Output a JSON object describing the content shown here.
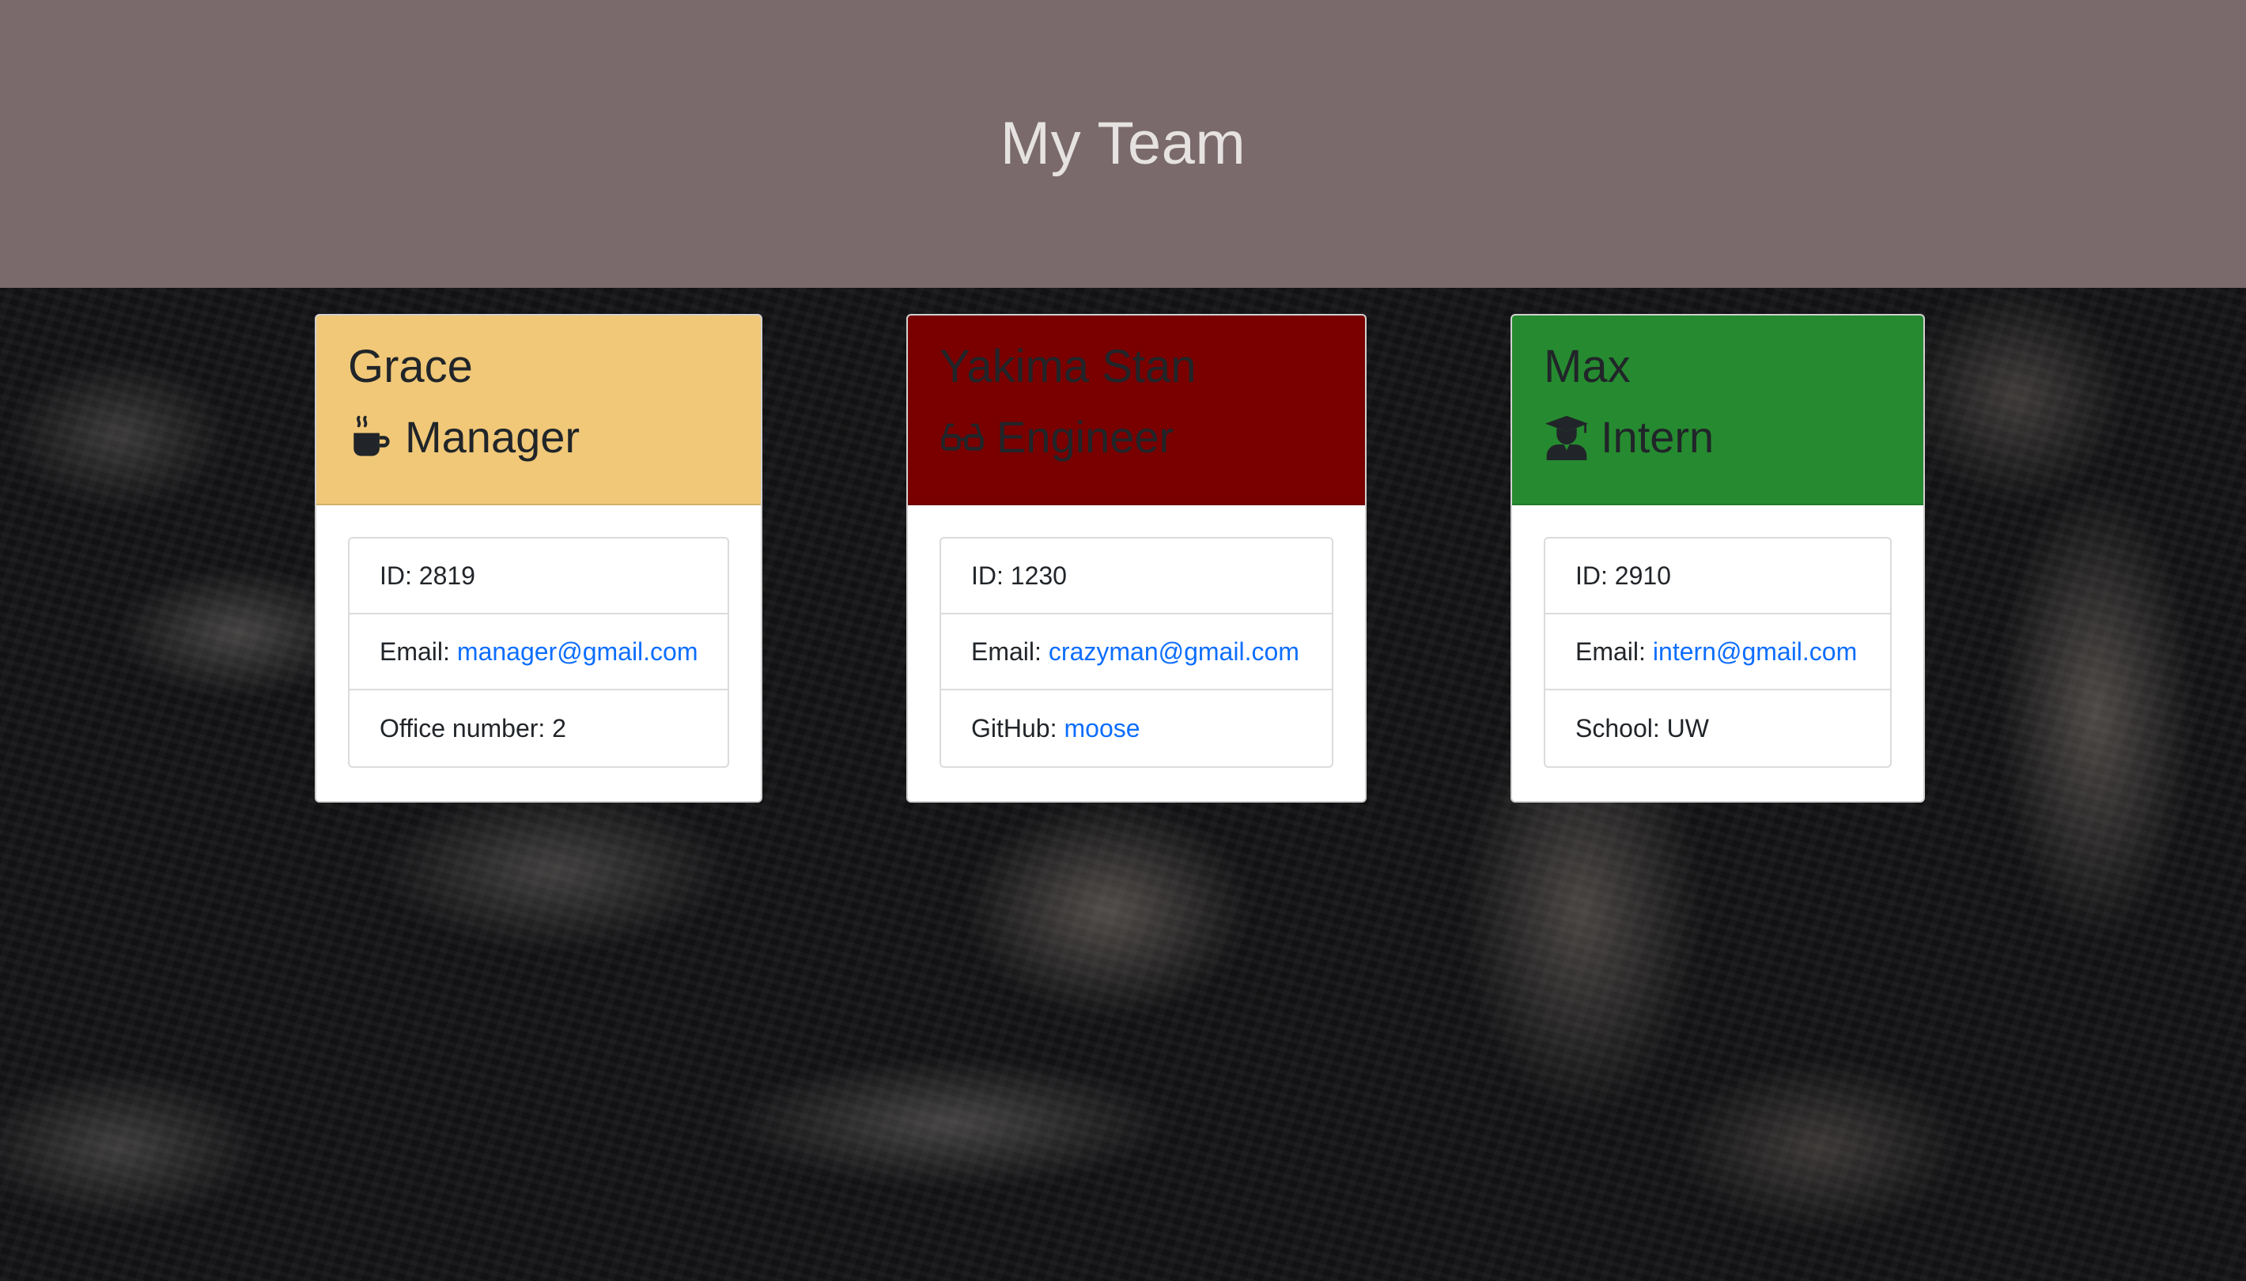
{
  "header": {
    "title": "My Team"
  },
  "colors": {
    "header_bg": "#7a6a6b",
    "manager_header": "#f0c878",
    "engineer_header": "#7a0000",
    "intern_header": "#268b30",
    "link": "#0d6efd"
  },
  "cards": [
    {
      "name": "Grace",
      "role": "Manager",
      "role_icon": "coffee-mug-icon",
      "id_label": "ID:",
      "id": "2819",
      "email_label": "Email:",
      "email": "manager@gmail.com",
      "extra_label": "Office number:",
      "extra_value": "2"
    },
    {
      "name": "Yakima Stan",
      "role": "Engineer",
      "role_icon": "glasses-icon",
      "id_label": "ID:",
      "id": "1230",
      "email_label": "Email:",
      "email": "crazyman@gmail.com",
      "extra_label": "GitHub:",
      "extra_value": "moose"
    },
    {
      "name": "Max",
      "role": "Intern",
      "role_icon": "graduate-icon",
      "id_label": "ID:",
      "id": "2910",
      "email_label": "Email:",
      "email": "intern@gmail.com",
      "extra_label": "School:",
      "extra_value": "UW"
    }
  ]
}
